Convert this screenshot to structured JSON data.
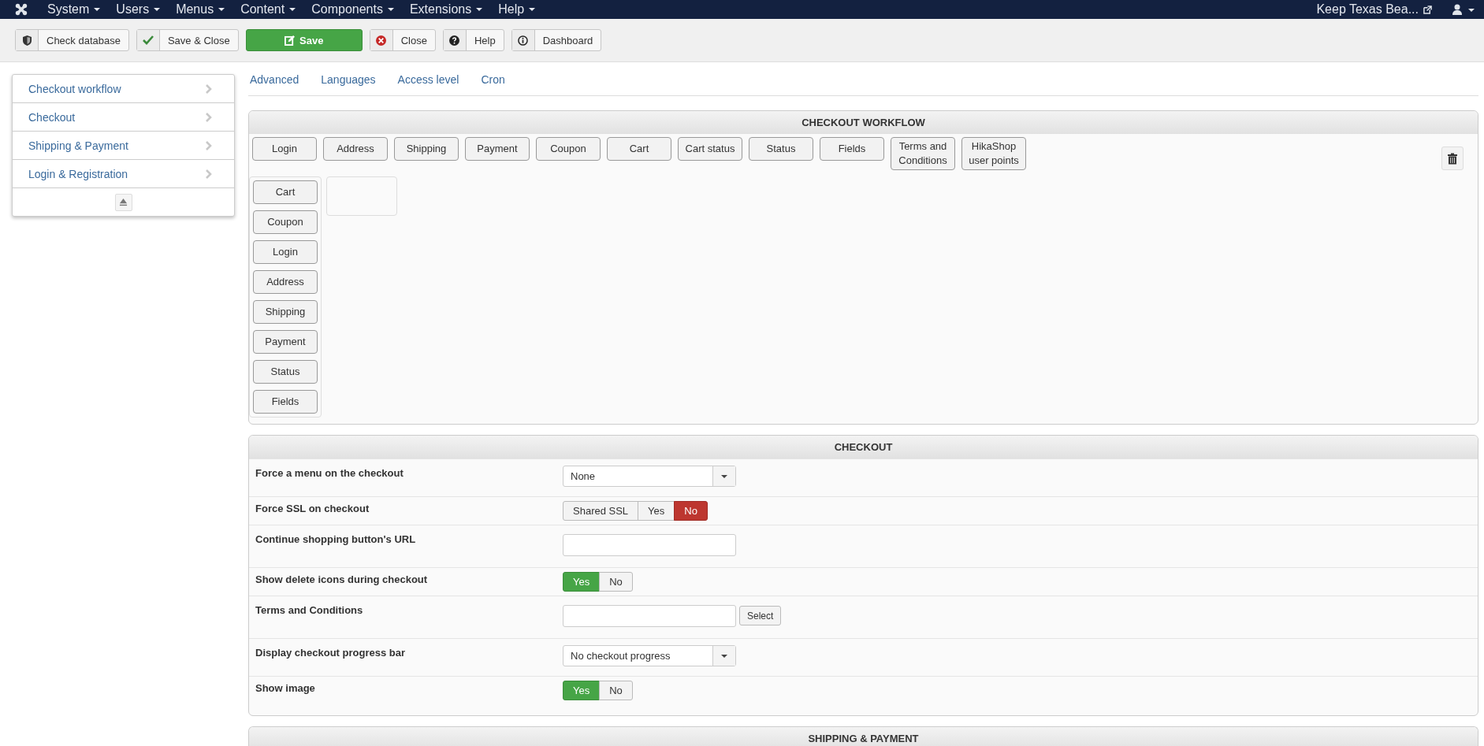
{
  "nav": {
    "menus": [
      "System",
      "Users",
      "Menus",
      "Content",
      "Components",
      "Extensions",
      "Help"
    ],
    "site_link": "Keep Texas Bea..."
  },
  "toolbar": {
    "buttons": [
      {
        "label": "Check database",
        "kind": "default"
      },
      {
        "label": "Save & Close",
        "kind": "default"
      },
      {
        "label": "Save",
        "kind": "primary"
      },
      {
        "label": "Close",
        "kind": "default"
      },
      {
        "label": "Help",
        "kind": "default"
      },
      {
        "label": "Dashboard",
        "kind": "default"
      }
    ]
  },
  "side_menu": {
    "items": [
      "Checkout workflow",
      "Checkout",
      "Shipping & Payment",
      "Login & Registration"
    ]
  },
  "tabs": [
    {
      "label": "Advanced",
      "selected": false
    },
    {
      "label": "Languages",
      "selected": false
    },
    {
      "label": "Access level",
      "selected": false
    },
    {
      "label": "Cron",
      "selected": false
    }
  ],
  "workflow": {
    "title": "CHECKOUT WORKFLOW",
    "available_blocks": [
      "Login",
      "Address",
      "Shipping",
      "Payment",
      "Coupon",
      "Cart",
      "Cart status",
      "Status",
      "Fields",
      "Terms and Conditions",
      "HikaShop user points"
    ],
    "steps": [
      {
        "blocks": [
          "Cart",
          "Coupon",
          "Login",
          "Address",
          "Shipping",
          "Payment",
          "Status",
          "Fields"
        ]
      },
      {
        "kind": "empty"
      }
    ]
  },
  "checkout": {
    "title": "CHECKOUT",
    "settings": [
      {
        "label": "Force a menu on the checkout",
        "kind": "select",
        "value": "None"
      },
      {
        "label": "Force SSL on checkout",
        "kind": "toggle",
        "options": [
          {
            "label": "Shared SSL",
            "selected": false
          },
          {
            "label": "Yes",
            "selected": false
          },
          {
            "label": "No",
            "kind": "no",
            "selected": true
          }
        ]
      },
      {
        "label": "Continue shopping button's URL",
        "kind": "text"
      },
      {
        "label": "Show delete icons during checkout",
        "kind": "toggle",
        "options": [
          {
            "label": "Yes",
            "kind": "yes",
            "selected": true
          },
          {
            "label": "No",
            "selected": false
          }
        ]
      },
      {
        "label": "Terms and Conditions",
        "kind": "text",
        "button": "Select"
      },
      {
        "label": "Display checkout progress bar",
        "kind": "select",
        "value": "No checkout progress"
      },
      {
        "label": "Show image",
        "kind": "toggle",
        "options": [
          {
            "label": "Yes",
            "kind": "yes",
            "selected": true
          },
          {
            "label": "No",
            "selected": false
          }
        ]
      }
    ]
  },
  "shipping": {
    "title": "SHIPPING & PAYMENT"
  }
}
